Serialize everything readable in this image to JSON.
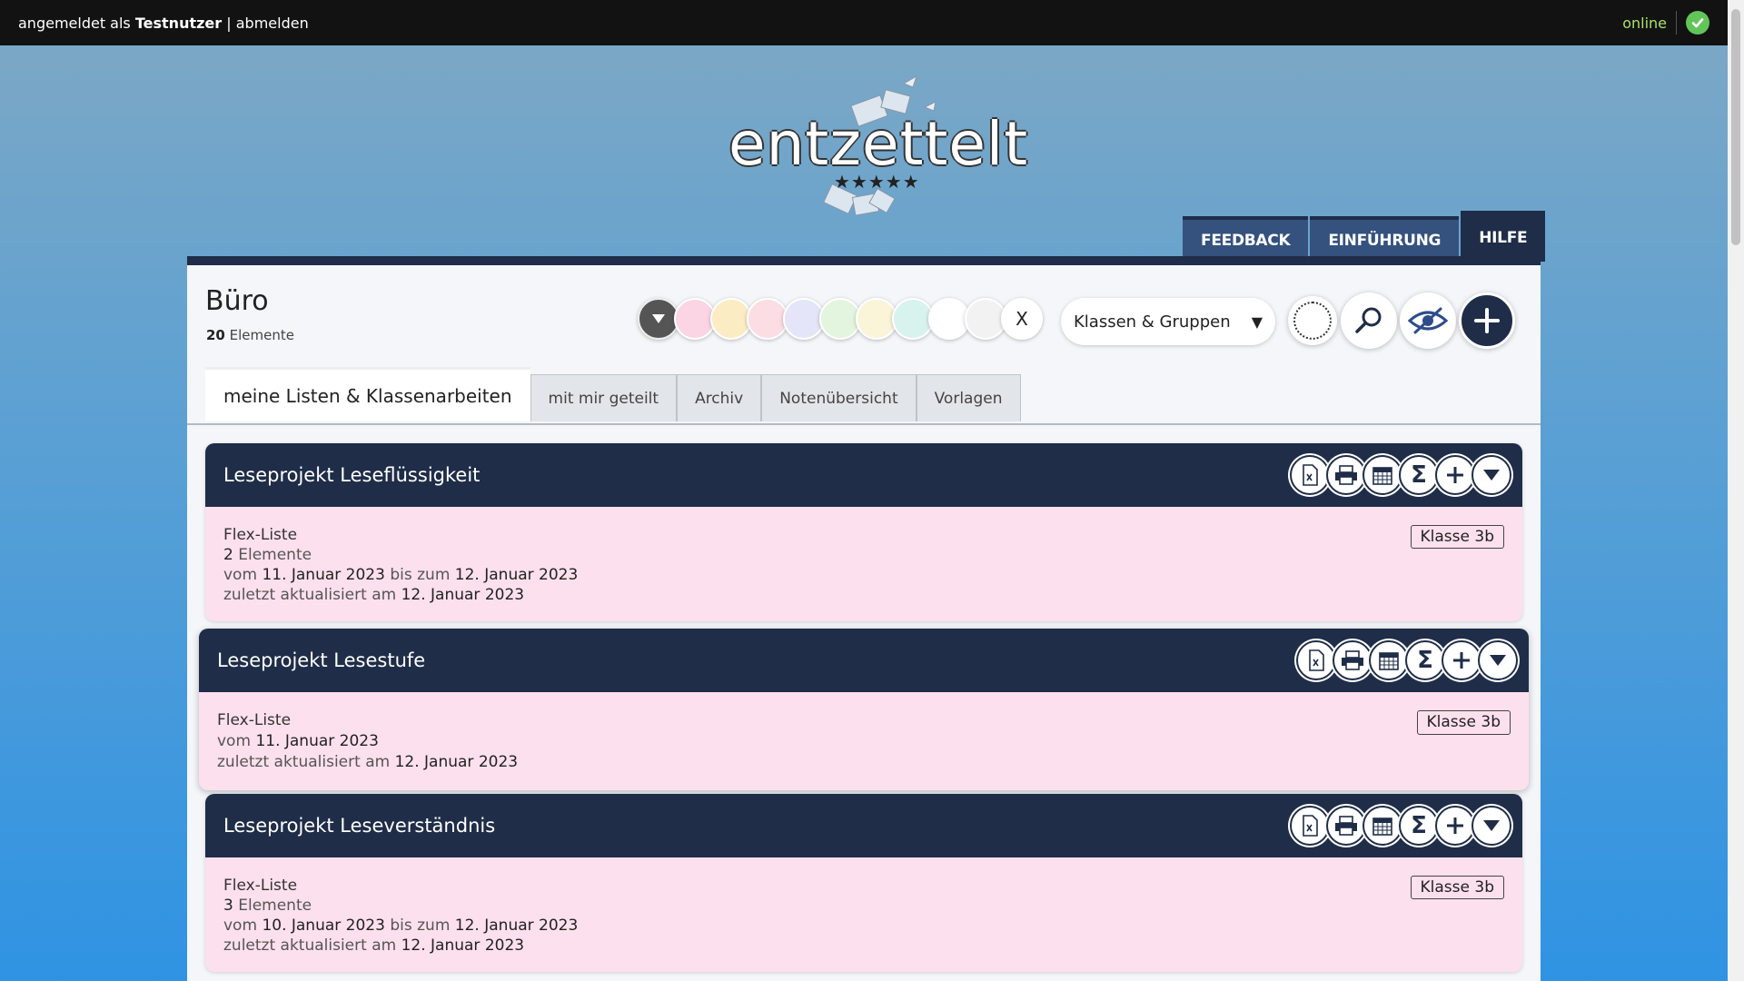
{
  "topbar": {
    "prefix": "angemeldet als",
    "user": "Testnutzer",
    "separator": "|",
    "logout": "abmelden",
    "status": "online"
  },
  "logo": {
    "word": "entzettelt",
    "stars": "★★★★★"
  },
  "nav": {
    "feedback": "FEEDBACK",
    "intro": "EINFÜHRUNG",
    "help": "HILFE"
  },
  "header": {
    "title": "Büro",
    "count": "20",
    "count_label": "Elemente"
  },
  "filters": {
    "chip_colors": [
      "#fbd5e4",
      "#fbecc4",
      "#fcdde3",
      "#e4e5f8",
      "#e3f5df",
      "#faf5d8",
      "#d8f3ee",
      "#ffffff",
      "#f2f2f2"
    ],
    "clear": "X",
    "group_select": "Klassen & Gruppen"
  },
  "tabs": [
    "meine Listen & Klassenarbeiten",
    "mit mir geteilt",
    "Archiv",
    "Notenübersicht",
    "Vorlagen"
  ],
  "cards": [
    {
      "title": "Leseprojekt Leseflüssigkeit",
      "type": "Flex-Liste",
      "elements": "2",
      "elements_label": "Elemente",
      "from_label": "vom",
      "from": "11. Januar 2023",
      "to_label": "bis zum",
      "to": "12. Januar 2023",
      "updated_label": "zuletzt aktualisiert am",
      "updated": "12. Januar 2023",
      "badge": "Klasse 3b"
    },
    {
      "title": "Leseprojekt Lesestufe",
      "type": "Flex-Liste",
      "from_label": "vom",
      "from": "11. Januar 2023",
      "updated_label": "zuletzt aktualisiert am",
      "updated": "12. Januar 2023",
      "badge": "Klasse 3b"
    },
    {
      "title": "Leseprojekt Leseverständnis",
      "type": "Flex-Liste",
      "elements": "3",
      "elements_label": "Elemente",
      "from_label": "vom",
      "from": "10. Januar 2023",
      "to_label": "bis zum",
      "to": "12. Januar 2023",
      "updated_label": "zuletzt aktualisiert am",
      "updated": "12. Januar 2023",
      "badge": "Klasse 3b"
    }
  ],
  "card_icons": [
    "excel-export-icon",
    "print-icon",
    "calendar-icon",
    "sum-icon",
    "add-icon",
    "expand-icon"
  ],
  "colors": {
    "navy": "#1f2d48",
    "card_bg": "#fde0ed",
    "online_green": "#62c55a"
  }
}
